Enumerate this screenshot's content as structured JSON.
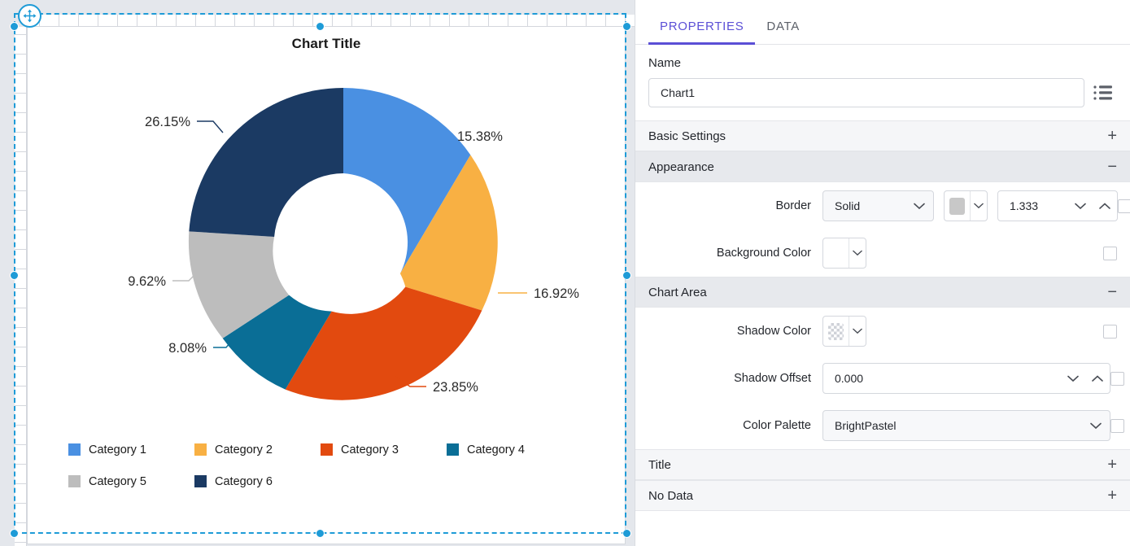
{
  "designer": {
    "move_handle_icon": "move-cross-icon",
    "selection_color": "#1e9bd7"
  },
  "chart": {
    "title": "Chart Title",
    "legend": [
      {
        "label": "Category 1",
        "color": "#4a90e2"
      },
      {
        "label": "Category 2",
        "color": "#f8b043"
      },
      {
        "label": "Category 3",
        "color": "#e24a0f"
      },
      {
        "label": "Category 4",
        "color": "#0a6e96"
      },
      {
        "label": "Category 5",
        "color": "#bdbdbd"
      },
      {
        "label": "Category 6",
        "color": "#1b3a63"
      }
    ]
  },
  "chart_data": {
    "type": "pie",
    "title": "Chart Title",
    "subtype": "doughnut",
    "labels": [
      "Category 1",
      "Category 2",
      "Category 3",
      "Category 4",
      "Category 5",
      "Category 6"
    ],
    "values": [
      15.38,
      16.92,
      23.85,
      8.08,
      9.62,
      26.15
    ],
    "value_labels": [
      "15.38%",
      "16.92%",
      "23.85%",
      "8.08%",
      "9.62%",
      "26.15%"
    ],
    "colors": [
      "#4a90e2",
      "#f8b043",
      "#e24a0f",
      "#0a6e96",
      "#bdbdbd",
      "#1b3a63"
    ],
    "units": "percent",
    "legend": "bottom",
    "label_position": "outside",
    "start_angle": 0,
    "direction": "clockwise",
    "inner_radius_ratio": 0.45,
    "xlabel": "",
    "ylabel": ""
  },
  "panel": {
    "tabs": [
      {
        "label": "PROPERTIES",
        "active": true
      },
      {
        "label": "DATA",
        "active": false
      }
    ],
    "accent_color": "#5b4fd6",
    "name": {
      "label": "Name",
      "value": "Chart1",
      "placeholder": "Name",
      "menu_icon": "list-menu-icon"
    },
    "sections": [
      {
        "title": "Basic Settings",
        "expanded": false,
        "toggle": "+"
      },
      {
        "title": "Appearance",
        "expanded": true,
        "toggle": "−"
      },
      {
        "title": "Chart Area",
        "expanded": true,
        "toggle": "−"
      },
      {
        "title": "Title",
        "expanded": false,
        "toggle": "+"
      },
      {
        "title": "No Data",
        "expanded": false,
        "toggle": "+"
      }
    ],
    "appearance": {
      "border": {
        "label": "Border",
        "style_value": "Solid",
        "color_value": "#c8c8c8",
        "width_value": "1.333"
      },
      "background_color": {
        "label": "Background Color",
        "color_value": "#ffffff"
      }
    },
    "chart_area": {
      "shadow_color": {
        "label": "Shadow Color",
        "color_value": "transparent"
      },
      "shadow_offset": {
        "label": "Shadow Offset",
        "value": "0.000"
      },
      "color_palette": {
        "label": "Color Palette",
        "value": "BrightPastel"
      }
    }
  }
}
